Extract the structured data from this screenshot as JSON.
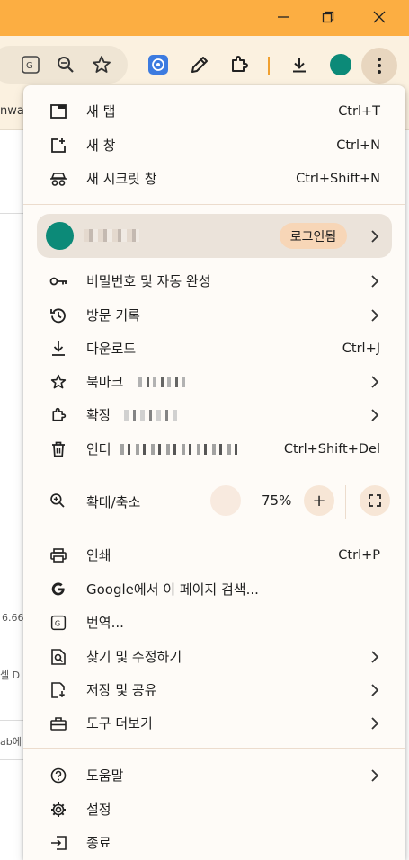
{
  "window": {
    "minimize_icon": "minimize-icon",
    "restore_icon": "restore-icon",
    "close_icon": "close-icon",
    "accent_color": "#fcae42"
  },
  "toolbar": {
    "icons": [
      "translate-icon",
      "zoom-icon",
      "bookmark-star-icon",
      "extension-icon",
      "pencil-icon",
      "puzzle-icon",
      "download-icon",
      "profile-avatar",
      "more-menu-icon"
    ]
  },
  "background": {
    "bookmark_text": "nwa",
    "snippet_1": "6.66",
    "snippet_2": "셀 D",
    "snippet_3": "ab에"
  },
  "menu": {
    "new_tab": {
      "label": "새 탭",
      "shortcut": "Ctrl+T"
    },
    "new_window": {
      "label": "새 창",
      "shortcut": "Ctrl+N"
    },
    "incognito": {
      "label": "새 시크릿 창",
      "shortcut": "Ctrl+Shift+N"
    },
    "profile": {
      "signin_label": "로그인됨"
    },
    "passwords": {
      "label": "비밀번호 및 자동 완성"
    },
    "history": {
      "label": "방문 기록"
    },
    "downloads": {
      "label": "다운로드",
      "shortcut": "Ctrl+J"
    },
    "bookmarks": {
      "label": "북마크"
    },
    "extensions": {
      "label": "확장"
    },
    "clear_data": {
      "label": "인터",
      "shortcut": "Ctrl+Shift+Del"
    },
    "zoom": {
      "label": "확대/축소",
      "value": "75%",
      "minus": "−",
      "plus": "+"
    },
    "print": {
      "label": "인쇄",
      "shortcut": "Ctrl+P"
    },
    "search_page": {
      "label": "Google에서 이 페이지 검색..."
    },
    "translate": {
      "label": "번역..."
    },
    "find_edit": {
      "label": "찾기 및 수정하기"
    },
    "save_share": {
      "label": "저장 및 공유"
    },
    "more_tools": {
      "label": "도구 더보기"
    },
    "help": {
      "label": "도움말"
    },
    "settings": {
      "label": "설정"
    },
    "exit": {
      "label": "종료"
    }
  }
}
